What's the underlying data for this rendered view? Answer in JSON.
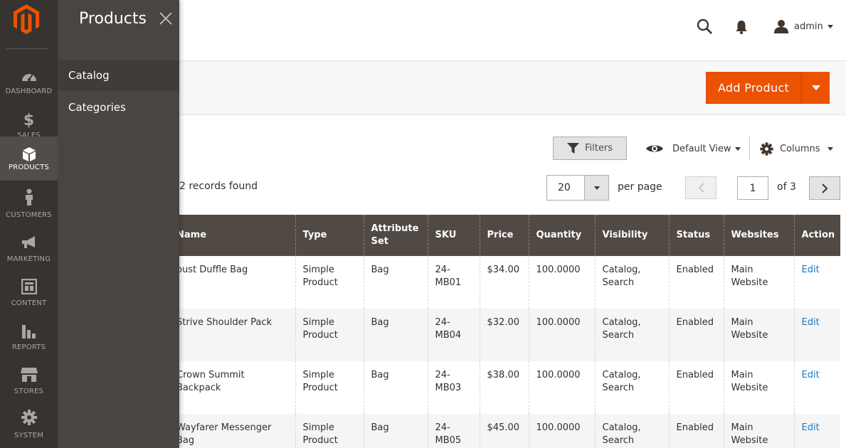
{
  "nav": {
    "items": [
      {
        "label": "DASHBOARD",
        "icon": "dashboard-gauge-icon"
      },
      {
        "label": "SALES",
        "icon": "dollar-icon"
      },
      {
        "label": "PRODUCTS",
        "icon": "box-icon"
      },
      {
        "label": "CUSTOMERS",
        "icon": "person-icon"
      },
      {
        "label": "MARKETING",
        "icon": "megaphone-icon"
      },
      {
        "label": "CONTENT",
        "icon": "layout-icon"
      },
      {
        "label": "REPORTS",
        "icon": "bar-chart-icon"
      },
      {
        "label": "STORES",
        "icon": "storefront-icon"
      },
      {
        "label": "SYSTEM",
        "icon": "gear-icon"
      }
    ]
  },
  "flyout": {
    "title": "Products",
    "section": "Catalog",
    "link": "Categories"
  },
  "header": {
    "user": "admin"
  },
  "actions": {
    "add_product": "Add Product"
  },
  "toolbar": {
    "filters": "Filters",
    "view": "Default View",
    "columns": "Columns",
    "records": "2 records found",
    "per_page_value": "20",
    "per_page_label": "per page",
    "page_value": "1",
    "page_of": "of 3"
  },
  "colors": {
    "accent": "#eb5202",
    "nav_bg": "#373330",
    "table_header": "#514943",
    "link": "#1979c3"
  },
  "table": {
    "headers": [
      "Name",
      "Type",
      "Attribute Set",
      "SKU",
      "Price",
      "Quantity",
      "Visibility",
      "Status",
      "Websites",
      "Action"
    ],
    "rows": [
      [
        "oust Duffle Bag",
        "Simple Product",
        "Bag",
        "24-MB01",
        "$34.00",
        "100.0000",
        "Catalog, Search",
        "Enabled",
        "Main Website",
        "Edit"
      ],
      [
        "Strive Shoulder Pack",
        "Simple Product",
        "Bag",
        "24-MB04",
        "$32.00",
        "100.0000",
        "Catalog, Search",
        "Enabled",
        "Main Website",
        "Edit"
      ],
      [
        "Crown Summit Backpack",
        "Simple Product",
        "Bag",
        "24-MB03",
        "$38.00",
        "100.0000",
        "Catalog, Search",
        "Enabled",
        "Main Website",
        "Edit"
      ],
      [
        "Wayfarer Messenger Bag",
        "Simple Product",
        "Bag",
        "24-MB05",
        "$45.00",
        "100.0000",
        "Catalog, Search",
        "Enabled",
        "Main Website",
        "Edit"
      ]
    ]
  }
}
